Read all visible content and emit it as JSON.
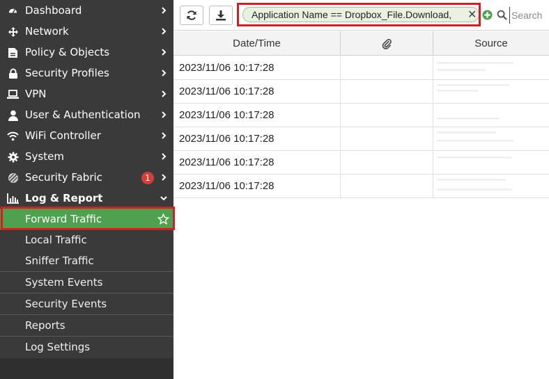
{
  "sidebar": {
    "items": [
      {
        "label": "Dashboard",
        "icon": "dashboard-icon"
      },
      {
        "label": "Network",
        "icon": "network-icon"
      },
      {
        "label": "Policy & Objects",
        "icon": "policy-icon"
      },
      {
        "label": "Security Profiles",
        "icon": "lock-icon"
      },
      {
        "label": "VPN",
        "icon": "laptop-icon"
      },
      {
        "label": "User & Authentication",
        "icon": "user-icon"
      },
      {
        "label": "WiFi Controller",
        "icon": "wifi-icon"
      },
      {
        "label": "System",
        "icon": "gear-icon"
      },
      {
        "label": "Security Fabric",
        "icon": "fabric-icon",
        "badge": "1"
      },
      {
        "label": "Log & Report",
        "icon": "chart-icon"
      }
    ],
    "log_report_subitems": [
      {
        "label": "Forward Traffic"
      },
      {
        "label": "Local Traffic"
      },
      {
        "label": "Sniffer Traffic"
      },
      {
        "label": "System Events"
      },
      {
        "label": "Security Events"
      },
      {
        "label": "Reports"
      },
      {
        "label": "Log Settings"
      }
    ]
  },
  "toolbar": {
    "filter_text": "Application Name == Dropbox_File.Download,",
    "search_placeholder": "Search"
  },
  "table": {
    "columns": [
      "Date/Time",
      "",
      "Source"
    ],
    "rows": [
      {
        "datetime": "2023/11/06 10:17:28"
      },
      {
        "datetime": "2023/11/06 10:17:28"
      },
      {
        "datetime": "2023/11/06 10:17:28"
      },
      {
        "datetime": "2023/11/06 10:17:28"
      },
      {
        "datetime": "2023/11/06 10:17:28"
      },
      {
        "datetime": "2023/11/06 10:17:28"
      }
    ]
  },
  "colors": {
    "sidebar_bg": "#3a3a3a",
    "active_item": "#4fa04f",
    "highlight_box": "#d21c26",
    "badge": "#d43f3a",
    "filter_pill_bg": "#e9f1e2"
  }
}
